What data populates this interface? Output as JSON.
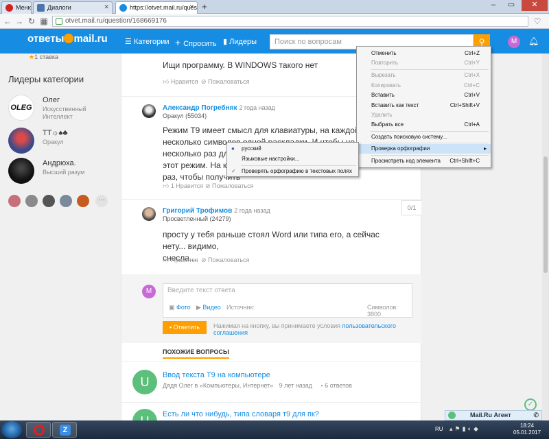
{
  "browser": {
    "tabs": [
      {
        "label": "Меню"
      },
      {
        "label": "Диалоги"
      },
      {
        "label": "https://otvet.mail.ru/quest"
      }
    ],
    "new_tab": "+",
    "url": "otvet.mail.ru/question/168669176"
  },
  "header": {
    "logo_text": "ответы",
    "logo_brand": "mail.ru",
    "nav": {
      "categories": "Категории",
      "ask": "Спросить",
      "leaders": "Лидеры"
    },
    "search_placeholder": "Поиск по вопросам",
    "avatar_letter": "M"
  },
  "sidebar": {
    "top_text": "1 ставка",
    "leaders_title": "Лидеры категории",
    "leaders": [
      {
        "name": "Олег",
        "rank": "Искусственный Интеллект"
      },
      {
        "name": "ТТ☼♠♣",
        "rank": "Оракул"
      },
      {
        "name": "Андрюха.",
        "rank": "Высший разум"
      }
    ],
    "more": "···"
  },
  "main": {
    "prev_answer": {
      "text": "Ищи программу. В WINDOWS такого нет",
      "like": "Нравится",
      "report": "Пожаловаться"
    },
    "answers": [
      {
        "author": "Александр Погребняк",
        "time": "2 года назад",
        "rank": "Оракул (55034)",
        "lines": [
          "Режим Т9 имеет смысл для клавиатуры, на каждой клавише",
          "несколько символов одной раскладки. И чтобы не нажимать",
          "несколько раз для п",
          "этот режим. На каку",
          "раз, чтобы получить"
        ],
        "like": "1 Нравится",
        "report": "Пожаловаться"
      },
      {
        "author": "Григорий Трофимов",
        "time": "2 года назад",
        "rank": "Просветленный (24279)",
        "lines": [
          "просту у тебя раньше стоял Word или типа его, а сейчас нету... видимо,",
          "снесла..."
        ],
        "like": "Нравится",
        "report": "Пожаловаться",
        "counter": "0/1"
      }
    ],
    "reply": {
      "placeholder": "Введите текст ответа",
      "photo": "Фото",
      "video": "Видео",
      "source": "Источник:",
      "chars": "Символов: 3800",
      "submit": "Ответить",
      "agreement_prefix": "Нажимая на кнопку, вы принимаете условия",
      "agreement_link": "пользовательского соглашения"
    },
    "similar": {
      "title": "ПОХОЖИЕ ВОПРОСЫ",
      "items": [
        {
          "title": "Ввод текста Т9 на компьютере",
          "author": "Дядя Олег в «Компьютеры, Интернет»",
          "time": "9 лет назад",
          "answers": "6 ответов"
        },
        {
          "title": "Есть ли что нибудь, типа словаря т9 для пк?",
          "author": "",
          "time": "",
          "answers": ""
        }
      ]
    }
  },
  "context_menu": {
    "items": [
      {
        "label": "Отменить",
        "shortcut": "Ctrl+Z",
        "enabled": true
      },
      {
        "label": "Повторить",
        "shortcut": "Ctrl+Y",
        "enabled": false
      },
      {
        "label": "Вырезать",
        "shortcut": "Ctrl+X",
        "enabled": false
      },
      {
        "label": "Копировать",
        "shortcut": "Ctrl+C",
        "enabled": false
      },
      {
        "label": "Вставить",
        "shortcut": "Ctrl+V",
        "enabled": true
      },
      {
        "label": "Вставить как текст",
        "shortcut": "Ctrl+Shift+V",
        "enabled": true
      },
      {
        "label": "Удалить",
        "shortcut": "",
        "enabled": false
      },
      {
        "label": "Выбрать все",
        "shortcut": "Ctrl+A",
        "enabled": true
      },
      {
        "label": "Создать поисковую систему...",
        "shortcut": "",
        "enabled": true
      },
      {
        "label": "Проверка орфографии",
        "shortcut": "",
        "enabled": true
      },
      {
        "label": "Просмотреть код элемента",
        "shortcut": "Ctrl+Shift+C",
        "enabled": true
      }
    ],
    "submenu": [
      {
        "label": "русский",
        "mark": "●"
      },
      {
        "label": "Языковые настройки...",
        "mark": ""
      },
      {
        "label": "Проверять орфографию в текстовых полях",
        "mark": "✓"
      }
    ]
  },
  "taskbar": {
    "lang": "RU",
    "time": "18:24",
    "date": "05.01.2017",
    "agent": "Mail.Ru Агент"
  },
  "colors": {
    "brand": "#168de2",
    "accent": "#ff9e00"
  }
}
